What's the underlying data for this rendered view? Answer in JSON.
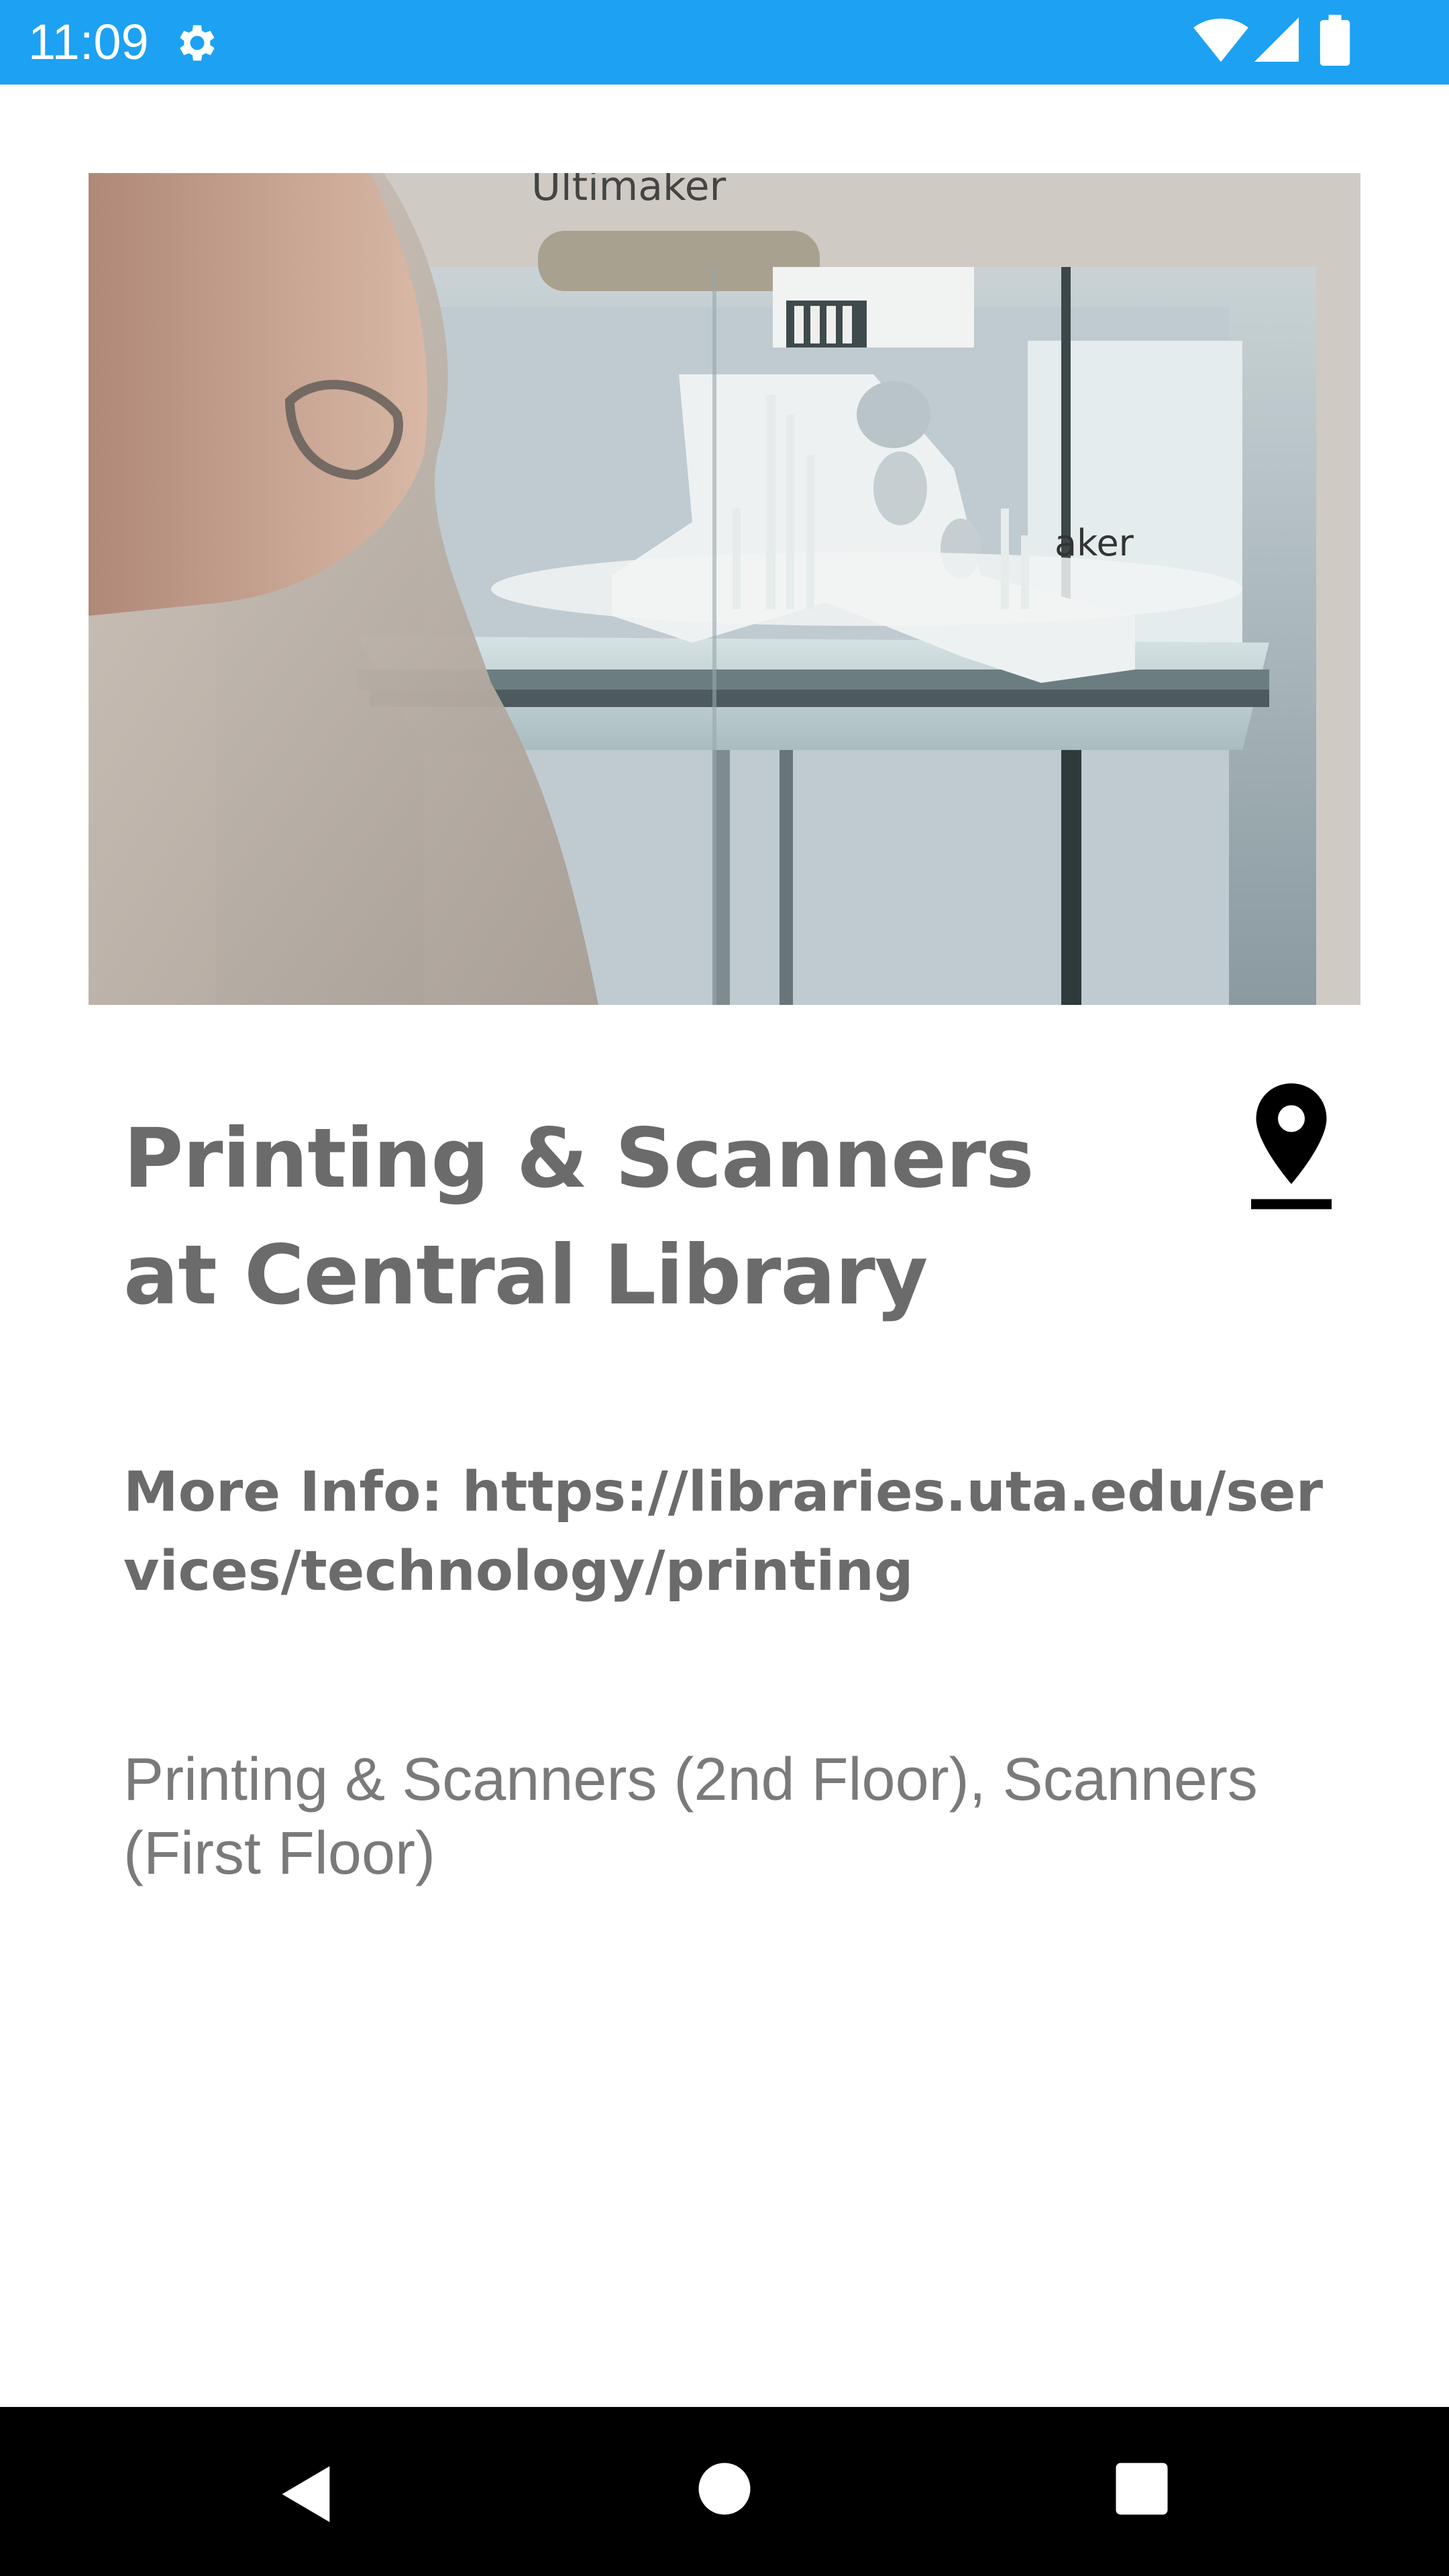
{
  "status_bar": {
    "time": "11:09",
    "color": "#1da1f2",
    "icons": [
      "gear-icon",
      "wifi-icon",
      "signal-icon",
      "battery-icon"
    ]
  },
  "hero": {
    "image_name": "3d-printer-photo",
    "printer_brand_text": "Ultimaker",
    "printer_side_text": "aker"
  },
  "detail": {
    "title": "Printing & Scanners at Central Library",
    "more_info_label": "More Info: ",
    "more_info_url": "https://libraries.uta.edu/services/technology/printing",
    "description": "Printing & Scanners (2nd Floor), Scanners (First Floor)",
    "location_icon": "map-pin-icon"
  },
  "nav_bar": {
    "icons": [
      "back-icon",
      "home-icon",
      "recents-icon"
    ]
  },
  "colors": {
    "text_primary": "#6b6b6b",
    "text_secondary": "#7a7a7a",
    "nav_background": "#000000"
  }
}
